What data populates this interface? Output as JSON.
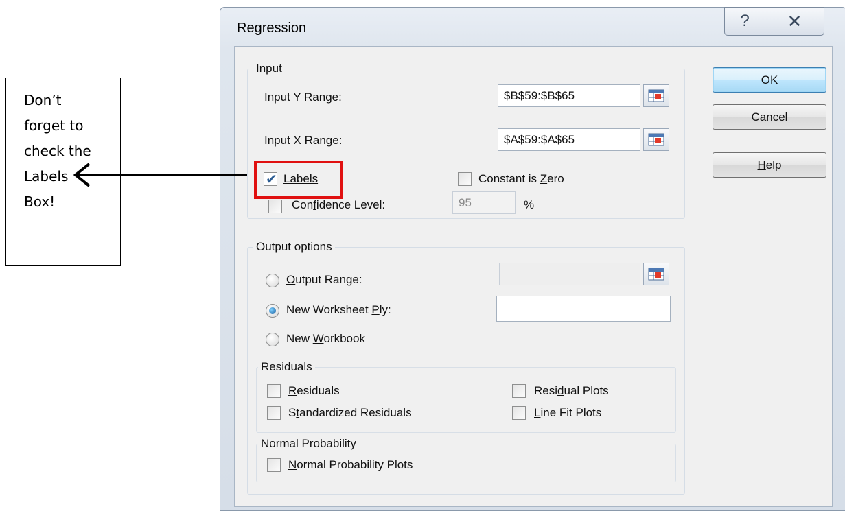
{
  "note": {
    "lines": [
      "Don’t",
      "forget to",
      "check the",
      "Labels",
      "Box!"
    ]
  },
  "dialog": {
    "title": "Regression",
    "help_icon": "?",
    "close_icon": "✕"
  },
  "input": {
    "legend": "Input",
    "y_range_label": "Input Y Range:",
    "y_range_value": "$B$59:$B$65",
    "x_range_label": "Input X Range:",
    "x_range_value": "$A$59:$A$65",
    "labels": "Labels",
    "labels_checked": true,
    "constant_zero": "Constant is Zero",
    "confidence": "Confidence Level:",
    "confidence_value": "95",
    "percent": "%"
  },
  "output": {
    "legend": "Output options",
    "output_range": "Output Range:",
    "new_ply": "New Worksheet Ply:",
    "new_workbook": "New Workbook",
    "selected": "new_ply"
  },
  "residuals": {
    "legend": "Residuals",
    "residuals": "Residuals",
    "standardized": "Standardized Residuals",
    "residual_plots": "Residual Plots",
    "line_fit": "Line Fit Plots"
  },
  "normal": {
    "legend": "Normal Probability",
    "plots": "Normal Probability Plots"
  },
  "buttons": {
    "ok": "OK",
    "cancel": "Cancel",
    "help": "Help"
  },
  "colors": {
    "highlight": "#e01010"
  }
}
